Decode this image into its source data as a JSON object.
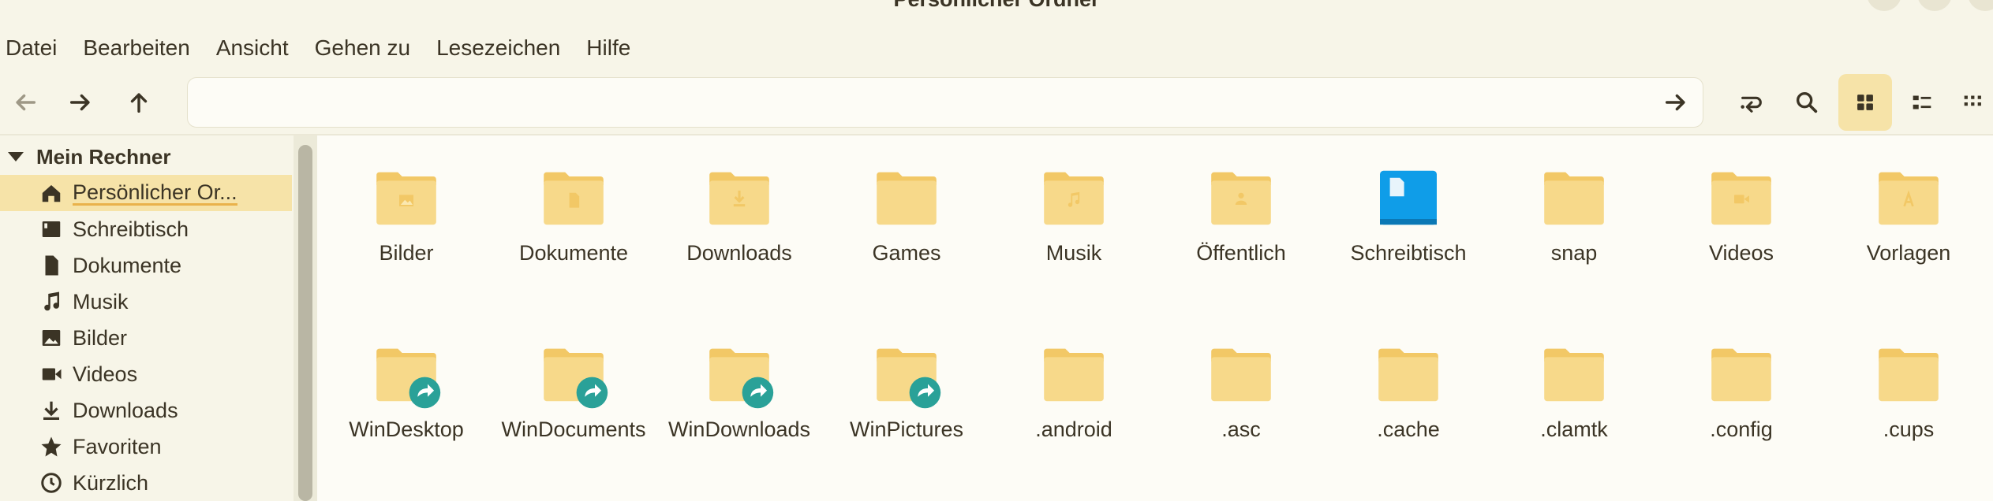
{
  "window": {
    "title": "Persönlicher Ordner"
  },
  "menubar": [
    "Datei",
    "Bearbeiten",
    "Ansicht",
    "Gehen zu",
    "Lesezeichen",
    "Hilfe"
  ],
  "location": {
    "value": "",
    "placeholder": ""
  },
  "sidebar": {
    "section": "Mein Rechner",
    "items": [
      {
        "label": "Persönlicher Or...",
        "icon": "home-icon",
        "selected": true
      },
      {
        "label": "Schreibtisch",
        "icon": "desktop-icon"
      },
      {
        "label": "Dokumente",
        "icon": "document-icon"
      },
      {
        "label": "Musik",
        "icon": "music-icon"
      },
      {
        "label": "Bilder",
        "icon": "image-icon"
      },
      {
        "label": "Videos",
        "icon": "video-icon"
      },
      {
        "label": "Downloads",
        "icon": "download-icon"
      },
      {
        "label": "Favoriten",
        "icon": "star-icon"
      },
      {
        "label": "Kürzlich",
        "icon": "clock-icon"
      }
    ]
  },
  "files": [
    {
      "name": "Bilder",
      "emblem": "image"
    },
    {
      "name": "Dokumente",
      "emblem": "document"
    },
    {
      "name": "Downloads",
      "emblem": "download"
    },
    {
      "name": "Games",
      "emblem": ""
    },
    {
      "name": "Musik",
      "emblem": "music"
    },
    {
      "name": "Öffentlich",
      "emblem": "person"
    },
    {
      "name": "Schreibtisch",
      "emblem": "desktop"
    },
    {
      "name": "snap",
      "emblem": ""
    },
    {
      "name": "Videos",
      "emblem": "video"
    },
    {
      "name": "Vorlagen",
      "emblem": "template"
    },
    {
      "name": "WinDesktop",
      "emblem": "link"
    },
    {
      "name": "WinDocuments",
      "emblem": "link"
    },
    {
      "name": "WinDownloads",
      "emblem": "link"
    },
    {
      "name": "WinPictures",
      "emblem": "link"
    },
    {
      "name": ".android",
      "emblem": ""
    },
    {
      "name": ".asc",
      "emblem": ""
    },
    {
      "name": ".cache",
      "emblem": ""
    },
    {
      "name": ".clamtk",
      "emblem": ""
    },
    {
      "name": ".config",
      "emblem": ""
    },
    {
      "name": ".cups",
      "emblem": ""
    }
  ],
  "colors": {
    "accent": "#e9b24b",
    "folder": "#f7d98a",
    "folder_dark": "#f2c866",
    "link": "#2aa198",
    "desktop": "#0f9de8"
  }
}
